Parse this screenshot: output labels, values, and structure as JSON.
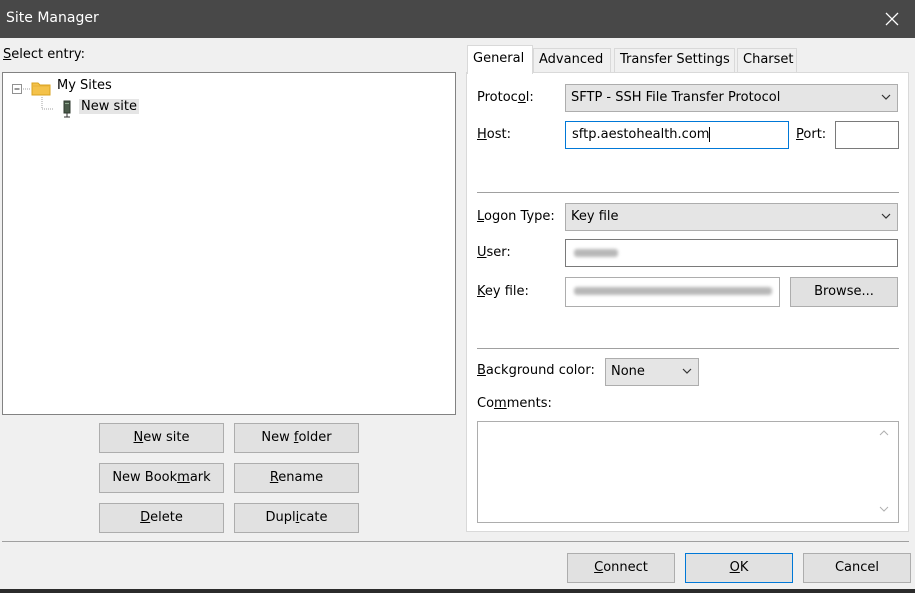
{
  "window": {
    "title": "Site Manager"
  },
  "left": {
    "select_entry_label_prefix": "S",
    "select_entry_label_rest": "elect entry:",
    "tree": {
      "root": "My Sites",
      "child": "New site"
    },
    "buttons": {
      "new_site": {
        "u": "N",
        "rest": "ew site"
      },
      "new_folder": {
        "pre": "New ",
        "u": "f",
        "rest": "older"
      },
      "new_bookmark": {
        "pre": "New Book",
        "u": "m",
        "rest": "ark"
      },
      "rename": {
        "u": "R",
        "rest": "ename"
      },
      "delete": {
        "u": "D",
        "rest": "elete"
      },
      "duplicate": {
        "pre": "Dupl",
        "u": "i",
        "rest": "cate"
      }
    }
  },
  "tabs": [
    "General",
    "Advanced",
    "Transfer Settings",
    "Charset"
  ],
  "general": {
    "protocol_label": {
      "pre": "Protoc",
      "u": "o",
      "rest": "l:"
    },
    "protocol_value": "SFTP - SSH File Transfer Protocol",
    "host_label": {
      "u": "H",
      "rest": "ost:"
    },
    "host_value": "sftp.aestohealth.com",
    "port_label": {
      "u": "P",
      "rest": "ort:"
    },
    "port_value": "",
    "logon_type_label": {
      "u": "L",
      "rest": "ogon Type:"
    },
    "logon_type_value": "Key file",
    "user_label": {
      "u": "U",
      "rest": "ser:"
    },
    "key_file_label": {
      "u": "K",
      "rest": "ey file:"
    },
    "browse_button": "Browse...",
    "background_color_label": {
      "u": "B",
      "rest": "ackground color:"
    },
    "background_color_value": "None",
    "comments_label": {
      "pre": "Co",
      "u": "m",
      "rest": "ments:"
    },
    "comments_value": ""
  },
  "footer": {
    "connect": {
      "u": "C",
      "rest": "onnect"
    },
    "ok": {
      "u": "O",
      "rest": "K"
    },
    "cancel": "Cancel"
  },
  "colors": {
    "titlebar": "#484848",
    "window_bg": "#f0f0f0",
    "focus_border": "#0078d7",
    "folder_icon": "#f4c24a"
  }
}
